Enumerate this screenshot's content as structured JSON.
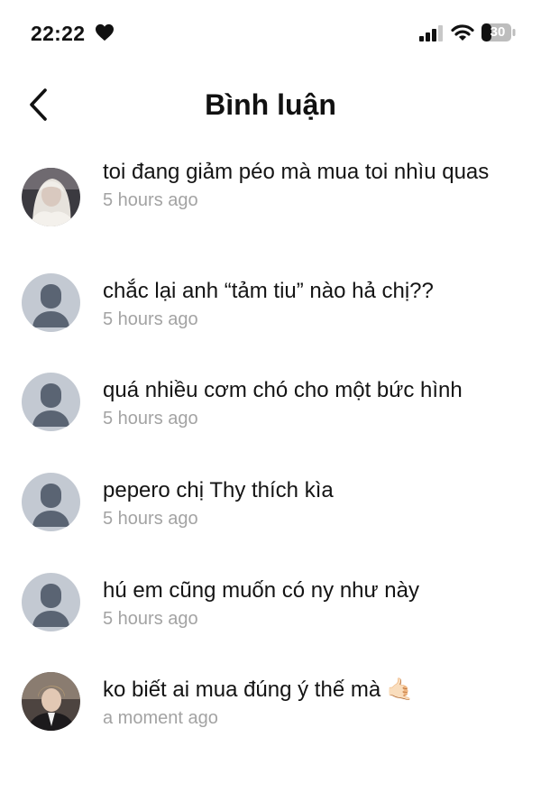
{
  "status_bar": {
    "time": "22:22",
    "battery": "30"
  },
  "header": {
    "title": "Bình luận"
  },
  "comments": [
    {
      "text": "toi đang giảm péo mà mua toi nhìu quas",
      "time": "5 hours ago",
      "avatar": "photo-girl"
    },
    {
      "text": "chắc lại anh “tảm tiu” nào hả chị??",
      "time": "5 hours ago",
      "avatar": "default"
    },
    {
      "text": "quá nhiều cơm chó cho một bức hình",
      "time": "5 hours ago",
      "avatar": "default"
    },
    {
      "text": "pepero chị Thy thích kìa",
      "time": "5 hours ago",
      "avatar": "default"
    },
    {
      "text": "hú em cũng muốn có ny như này",
      "time": "5 hours ago",
      "avatar": "default"
    },
    {
      "text": "ko biết ai mua đúng ý thế mà 🤙🏻",
      "time": "a moment ago",
      "avatar": "photo-boy"
    }
  ]
}
